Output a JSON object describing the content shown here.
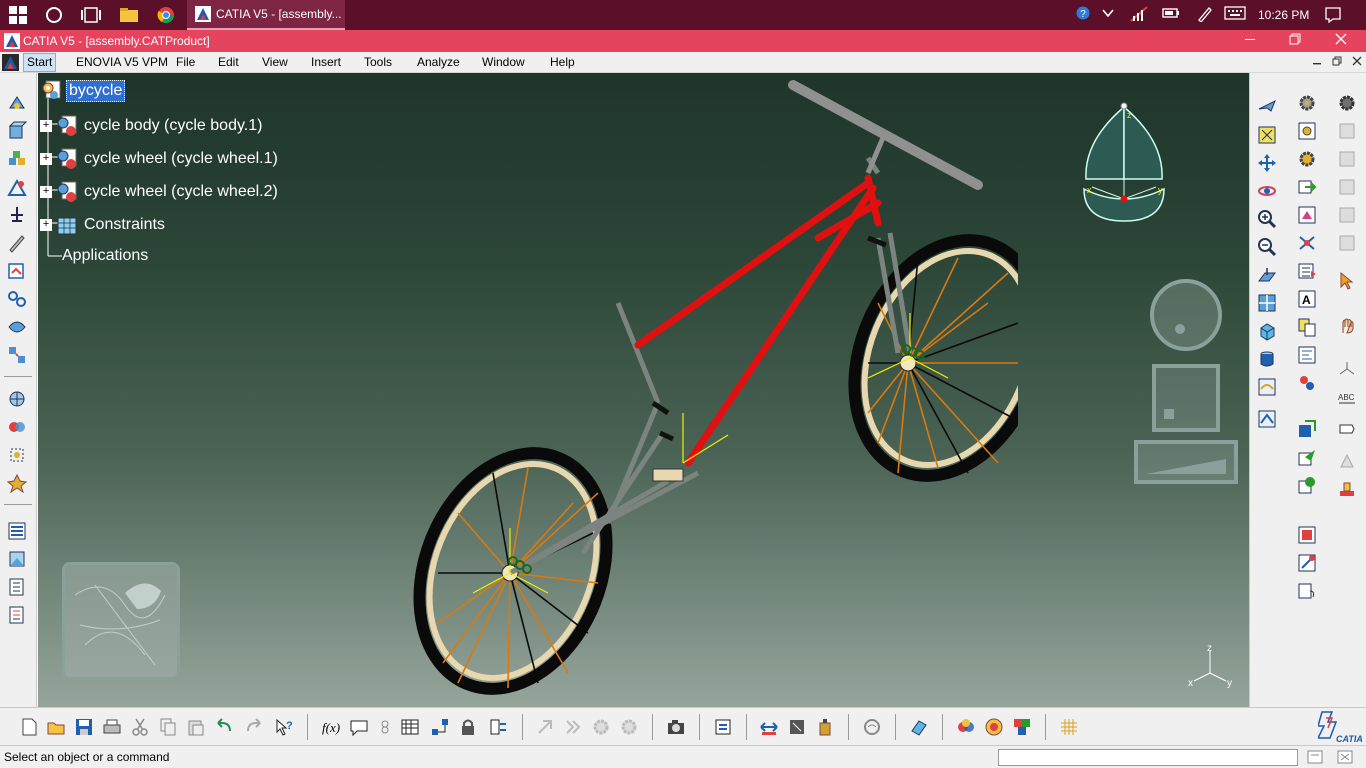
{
  "taskbar": {
    "task_label": "CATIA V5 - [assembly...",
    "clock": "10:26 PM"
  },
  "window": {
    "title": "CATIA V5 - [assembly.CATProduct]"
  },
  "menu": {
    "items": [
      "Start",
      "ENOVIA V5 VPM",
      "File",
      "Edit",
      "View",
      "Insert",
      "Tools",
      "Analyze",
      "Window",
      "Help"
    ]
  },
  "tree": {
    "root": "bycycle",
    "nodes": [
      {
        "label": "cycle body (cycle body.1)"
      },
      {
        "label": "cycle wheel (cycle wheel.1)"
      },
      {
        "label": "cycle wheel (cycle wheel.2)"
      },
      {
        "label": "Constraints"
      }
    ],
    "applications": "Applications"
  },
  "compass": {
    "z_label": "z",
    "x_label": "x",
    "y_label": "y"
  },
  "axes": {
    "z": "z",
    "x": "x",
    "y": "y"
  },
  "brand": {
    "logo_text": "CATIA"
  },
  "colors": {
    "frame": "#e01010",
    "spokes": "#d97a10",
    "rim": "#e8d8b0",
    "tire": "#0a0a0a",
    "accent_selection": "#2f6fd0"
  },
  "status": {
    "message": "Select an object or a command"
  }
}
